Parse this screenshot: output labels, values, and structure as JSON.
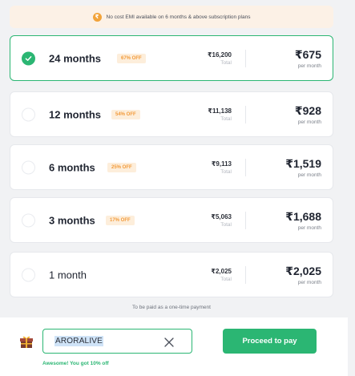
{
  "emi_notice": {
    "icon": "rupee-coin-icon",
    "text": "No cost EMI available on 6 months & above subscription plans"
  },
  "plans": [
    {
      "name": "24 months",
      "off": "67% OFF",
      "total": "₹16,200",
      "total_label": "Total",
      "price": "₹675",
      "price_label": "per month",
      "selected": true
    },
    {
      "name": "12 months",
      "off": "54% OFF",
      "total": "₹11,138",
      "total_label": "Total",
      "price": "₹928",
      "price_label": "per month",
      "selected": false
    },
    {
      "name": "6 months",
      "off": "25% OFF",
      "total": "₹9,113",
      "total_label": "Total",
      "price": "₹1,519",
      "price_label": "per month",
      "selected": false
    },
    {
      "name": "3 months",
      "off": "17% OFF",
      "total": "₹5,063",
      "total_label": "Total",
      "price": "₹1,688",
      "price_label": "per month",
      "selected": false
    },
    {
      "name": "1 month",
      "off": "",
      "total": "₹2,025",
      "total_label": "Total",
      "price": "₹2,025",
      "price_label": "per month",
      "selected": false
    }
  ],
  "one_time_note": "To be paid as a one-time payment",
  "footer": {
    "coupon_code": "ARORALIVE",
    "coupon_message": "Awesome! You got 10% off",
    "proceed_label": "Proceed to pay"
  },
  "colors": {
    "accent_green": "#2bb673",
    "badge_orange": "#f29a3a",
    "badge_bg": "#fdeedb",
    "banner_bg": "#fcf1e6"
  }
}
